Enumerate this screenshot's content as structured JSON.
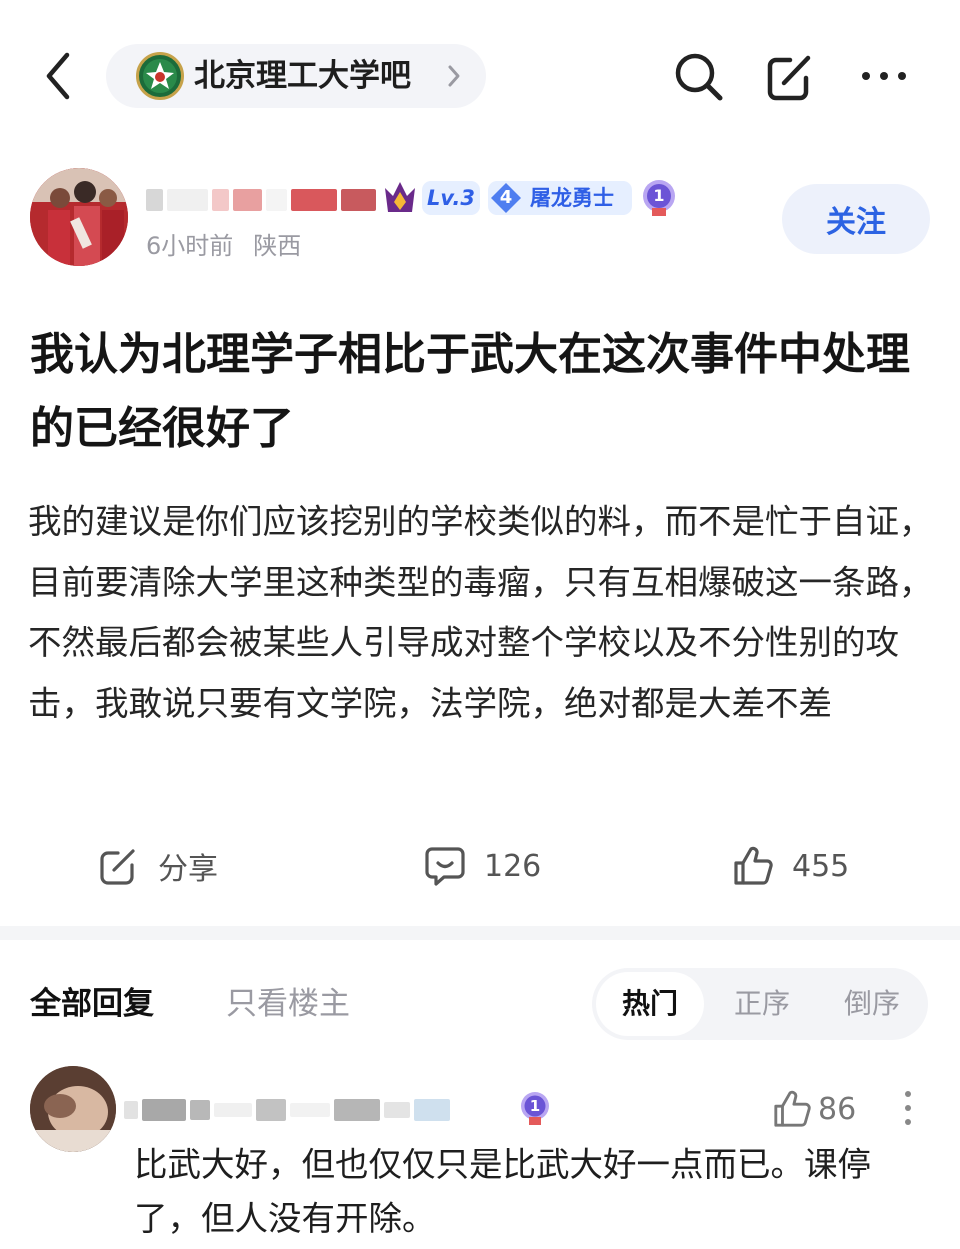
{
  "topbar": {
    "forum_name": "北京理工大学吧",
    "icons": [
      "back-arrow-icon",
      "forum-logo-icon",
      "chevron-right-icon",
      "search-icon",
      "edit-icon",
      "more-dots-icon"
    ]
  },
  "author": {
    "level_badge": "Lv.3",
    "title_badge_number": "4",
    "title_badge_text": "屠龙勇士",
    "medal_number": "1",
    "time": "6小时前",
    "location": "陕西",
    "follow_label": "关注"
  },
  "post": {
    "title": "我认为北理学子相比于武大在这次事件中处理的已经很好了",
    "body": "我的建议是你们应该挖别的学校类似的料，而不是忙于自证，目前要清除大学里这种类型的毒瘤，只有互相爆破这一条路，不然最后都会被某些人引导成对整个学校以及不分性别的攻击，我敢说只要有文学院，法学院，绝对都是大差不差"
  },
  "actions": {
    "share_label": "分享",
    "comment_count": "126",
    "like_count": "455"
  },
  "replies": {
    "tab_all": "全部回复",
    "tab_op_only": "只看楼主",
    "sort_hot": "热门",
    "sort_asc": "正序",
    "sort_desc": "倒序"
  },
  "comment": {
    "medal_number": "1",
    "like_count": "86",
    "text": "比武大好，但也仅仅只是比武大好一点而已。课停了，但人没有开除。"
  },
  "colors": {
    "accent_blue": "#2c63e3",
    "badge_bg": "#e6efff",
    "medal_purple": "#6b54d6",
    "crown_purple": "#6a2a8a",
    "muted_text": "#9a9aa2"
  }
}
